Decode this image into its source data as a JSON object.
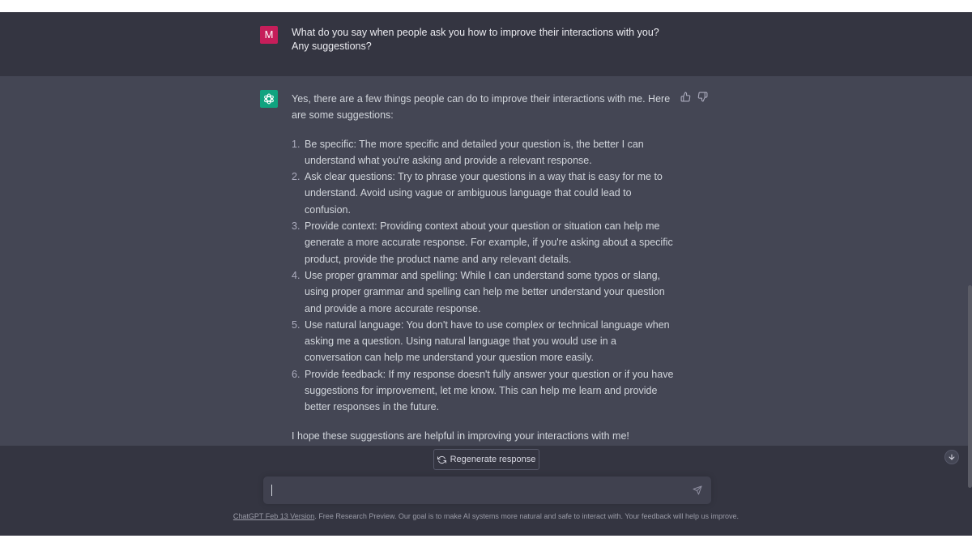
{
  "user_message": {
    "avatar_letter": "M",
    "text": "What do you say when people ask you how to improve their interactions with you? Any suggestions?"
  },
  "assistant_message": {
    "intro": "Yes, there are a few things people can do to improve their interactions with me. Here are some suggestions:",
    "items": [
      {
        "num": "1.",
        "text": "Be specific: The more specific and detailed your question is, the better I can understand what you're asking and provide a relevant response."
      },
      {
        "num": "2.",
        "text": "Ask clear questions: Try to phrase your questions in a way that is easy for me to understand. Avoid using vague or ambiguous language that could lead to confusion."
      },
      {
        "num": "3.",
        "text": "Provide context: Providing context about your question or situation can help me generate a more accurate response. For example, if you're asking about a specific product, provide the product name and any relevant details."
      },
      {
        "num": "4.",
        "text": "Use proper grammar and spelling: While I can understand some typos or slang, using proper grammar and spelling can help me better understand your question and provide a more accurate response."
      },
      {
        "num": "5.",
        "text": "Use natural language: You don't have to use complex or technical language when asking me a question. Using natural language that you would use in a conversation can help me understand your question more easily."
      },
      {
        "num": "6.",
        "text": "Provide feedback: If my response doesn't fully answer your question or if you have suggestions for improvement, let me know. This can help me learn and provide better responses in the future."
      }
    ],
    "outro": "I hope these suggestions are helpful in improving your interactions with me!"
  },
  "regenerate_label": "Regenerate response",
  "input": {
    "value": ""
  },
  "footer": {
    "link_text": "ChatGPT Feb 13 Version",
    "text": ". Free Research Preview. Our goal is to make AI systems more natural and safe to interact with. Your feedback will help us improve."
  },
  "colors": {
    "background": "#343541",
    "assistant_background": "#444654",
    "user_avatar": "#c61e5a",
    "assistant_avatar": "#10a37f"
  },
  "icons": [
    "openai-logo-icon",
    "thumbs-up-icon",
    "thumbs-down-icon",
    "refresh-icon",
    "send-icon",
    "arrow-down-icon"
  ]
}
